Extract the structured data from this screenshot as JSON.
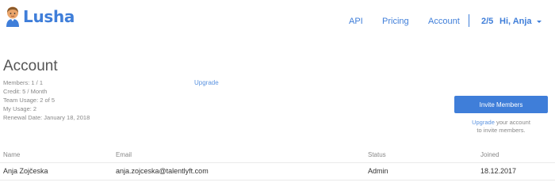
{
  "header": {
    "logo_text": "Lusha",
    "nav": {
      "api": "API",
      "pricing": "Pricing",
      "account": "Account"
    },
    "usage_count": "2/5",
    "user_greeting": "Hi, Anja"
  },
  "account": {
    "title": "Account",
    "members": "Members: 1 / 1",
    "credit": "Credit: 5 / Month",
    "team_usage": "Team Usage: 2 of 5",
    "my_usage": "My Usage: 2",
    "renewal_date": "Renewal Date: January 18, 2018",
    "upgrade_link": "Upgrade"
  },
  "invite": {
    "button_label": "Invite Members",
    "hint_link": "Upgrade",
    "hint_text_1": " your account",
    "hint_text_2": "to invite members."
  },
  "table": {
    "headers": {
      "name": "Name",
      "email": "Email",
      "status": "Status",
      "joined": "Joined"
    },
    "rows": [
      {
        "name": "Anja Zojčeska",
        "email": "anja.zojceska@talentlyft.com",
        "status": "Admin",
        "joined": "18.12.2017"
      }
    ]
  },
  "colors": {
    "accent": "#3f7ed9"
  }
}
